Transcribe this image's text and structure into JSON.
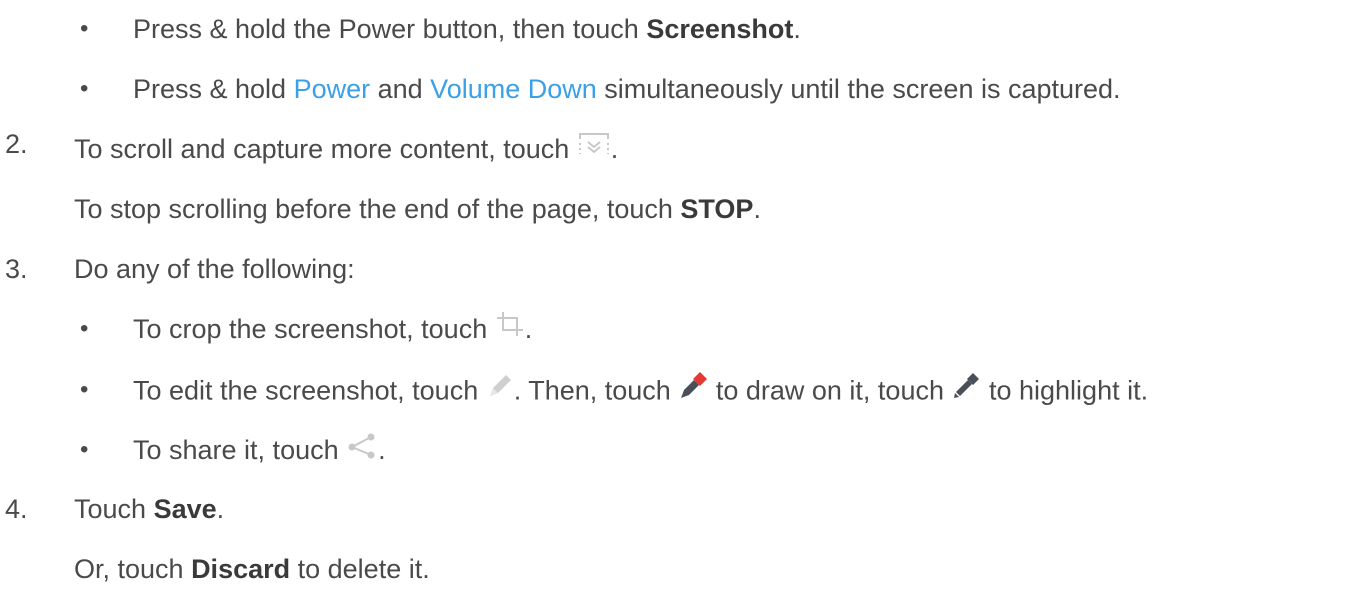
{
  "steps": {
    "step1": {
      "bullet_a": {
        "text_1": "Press & hold the Power button, then touch ",
        "bold_1": "Screenshot",
        "text_2": "."
      },
      "bullet_b": {
        "text_1": "Press & hold ",
        "link_1": "Power",
        "text_2": " and ",
        "link_2": "Volume Down",
        "text_3": " simultaneously until the screen is captured."
      }
    },
    "step2": {
      "number": "2.",
      "line_1": {
        "text_1": "To scroll and capture more content, touch ",
        "text_2": "."
      },
      "line_2": {
        "text_1": "To stop scrolling before the end of the page, touch ",
        "bold_1": "STOP",
        "text_2": "."
      }
    },
    "step3": {
      "number": "3.",
      "text": "Do any of the following:",
      "bullet_crop": {
        "text_1": "To crop the screenshot, touch ",
        "text_2": "."
      },
      "bullet_edit": {
        "text_1": "To edit the screenshot, touch ",
        "text_2": ". Then, touch ",
        "text_3": " to draw on it, touch ",
        "text_4": " to highlight it."
      },
      "bullet_share": {
        "text_1": "To share it, touch ",
        "text_2": "."
      }
    },
    "step4": {
      "number": "4.",
      "line_1": {
        "text_1": "Touch ",
        "bold_1": "Save",
        "text_2": "."
      },
      "line_2": {
        "text_1": "Or, touch ",
        "bold_1": "Discard",
        "text_2": " to delete it."
      }
    }
  },
  "bullet_char": "•",
  "icons": {
    "scroll": "scroll-capture-icon",
    "crop": "crop-icon",
    "edit": "pencil-icon",
    "draw": "red-pen-icon",
    "highlight": "highlighter-icon",
    "share": "share-icon"
  },
  "colors": {
    "text": "#4a4a4a",
    "link": "#3aa0e8",
    "icon_gray": "#c8c8c8",
    "pen_red": "#e53935",
    "pen_dark": "#4a4f5a"
  }
}
